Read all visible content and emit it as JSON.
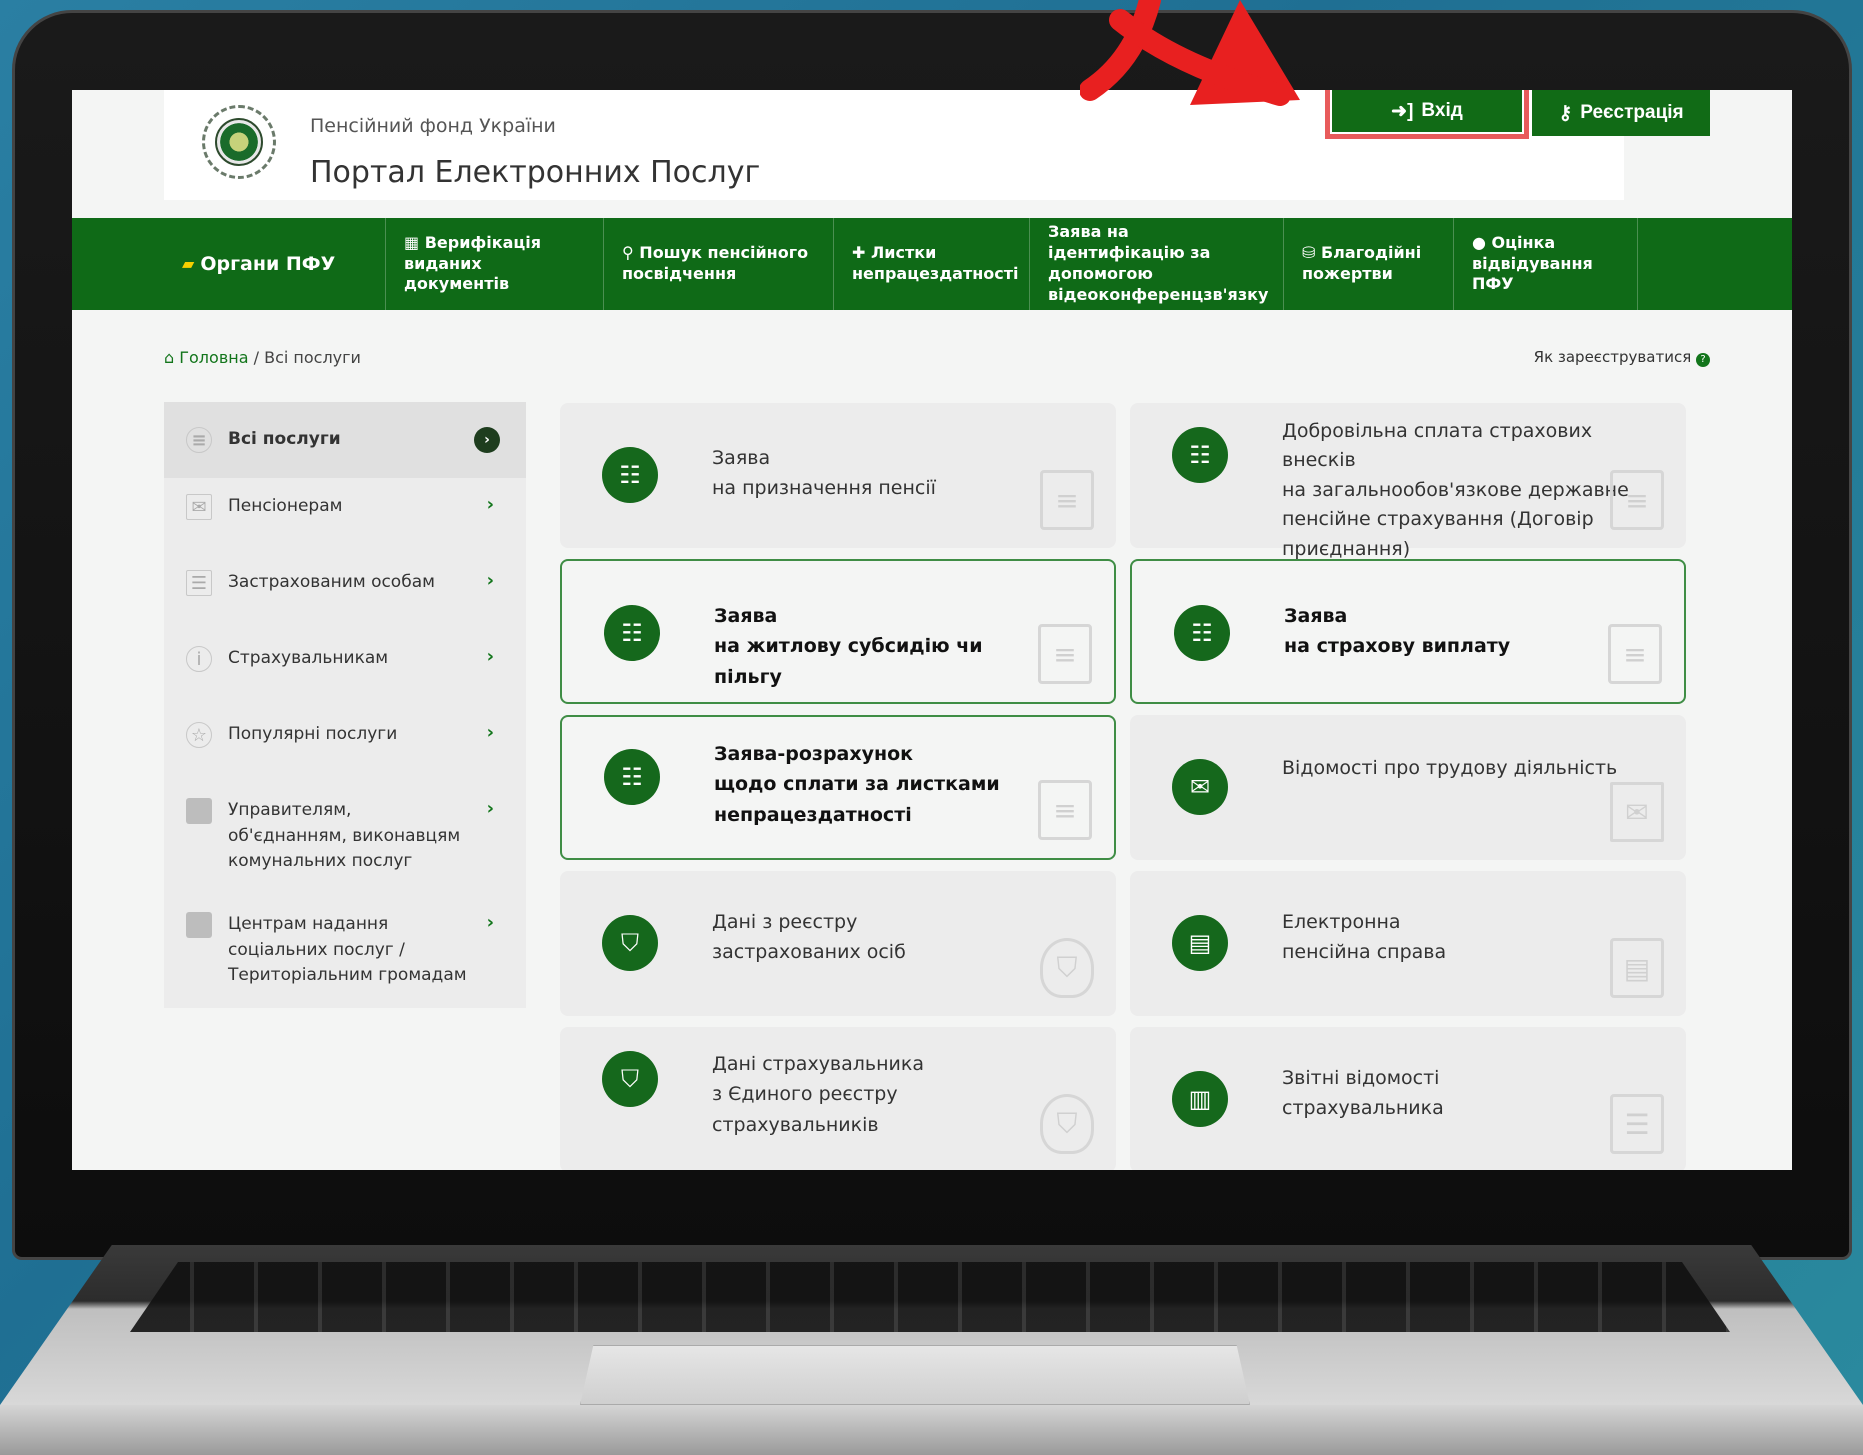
{
  "header": {
    "org_small": "Пенсійний фонд України",
    "org_title": "Портал Електронних Послуг",
    "login_label": "Вхід",
    "register_label": "Реєстрація"
  },
  "nav": [
    {
      "label": "Органи ПФУ",
      "icon": "ukraine-map-icon"
    },
    {
      "label": "Верифікація виданих документів",
      "icon": "qr-icon"
    },
    {
      "label": "Пошук пенсійного посвідчення",
      "icon": "search-icon"
    },
    {
      "label": "Листки непрацездатності",
      "icon": "medical-bag-icon"
    },
    {
      "label": "Заява на ідентифікацію за допомогою відеоконференцзв'язку",
      "icon": ""
    },
    {
      "label": "Благодійні пожертви",
      "icon": "donation-icon"
    },
    {
      "label": "Оцінка відвідування ПФУ",
      "icon": "comment-icon"
    }
  ],
  "breadcrumb": {
    "home": "Головна",
    "current": "Всі послуги"
  },
  "howto": "Як зареєструватися",
  "sidebar": [
    {
      "label": "Всі послуги",
      "icon": "list-icon"
    },
    {
      "label": "Пенсіонерам",
      "icon": "envelope-icon"
    },
    {
      "label": "Застрахованим особам",
      "icon": "document-icon"
    },
    {
      "label": "Страхувальникам",
      "icon": "info-icon"
    },
    {
      "label": "Популярні послуги",
      "icon": "star-icon"
    },
    {
      "label": "Управителям, об'єднанням, виконавцям комунальних послуг",
      "icon": "folder-icon"
    },
    {
      "label": "Центрам надання соціальних послуг / Територіальним громадам",
      "icon": "folder-icon"
    }
  ],
  "cards": [
    {
      "line1": "Заява",
      "line2": "на призначення пенсії",
      "line3": "",
      "icon": "form-icon"
    },
    {
      "line1": "Добровільна сплата страхових внесків",
      "line2": "на загальнообов'язкове державне",
      "line3": "пенсійне страхування (Договір",
      "line4": "приєднання)",
      "icon": "form-icon"
    },
    {
      "line1": "Заява",
      "line2": "на житлову субсидію чи пільгу",
      "line3": "",
      "icon": "form-icon"
    },
    {
      "line1": "Заява",
      "line2": "на страхову виплату",
      "line3": "",
      "icon": "form-icon"
    },
    {
      "line1": "Заява-розрахунок",
      "line2": "щодо сплати за листками",
      "line3": "непрацездатності",
      "icon": "form-icon"
    },
    {
      "line1": "Відомості про трудову діяльність",
      "line2": "",
      "line3": "",
      "icon": "envelope-icon"
    },
    {
      "line1": "Дані з реєстру",
      "line2": "застрахованих осіб",
      "line3": "",
      "icon": "shield-icon"
    },
    {
      "line1": "Електронна",
      "line2": "пенсійна справа",
      "line3": "",
      "icon": "folder-doc-icon"
    },
    {
      "line1": "Дані страхувальника",
      "line2": "з Єдиного реєстру",
      "line3": "страхувальників",
      "icon": "shield-icon"
    },
    {
      "line1": "Звітні відомості",
      "line2": "страхувальника",
      "line3": "",
      "icon": "report-icon"
    }
  ],
  "colors": {
    "primary_green": "#116b16",
    "highlight_red": "#e85b5b"
  }
}
